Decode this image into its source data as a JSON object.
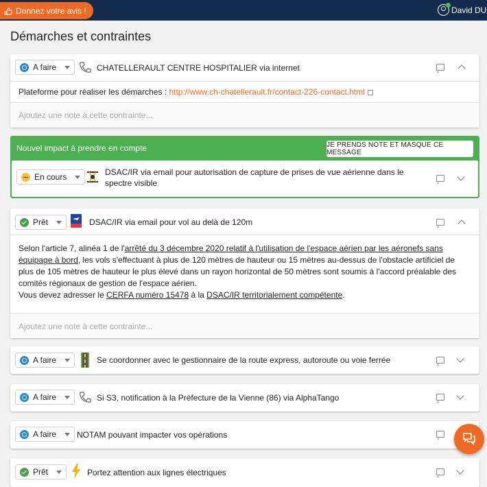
{
  "header": {
    "feedback_label": "Donnez votre avis !",
    "user_name": "David DUR"
  },
  "page": {
    "title": "Démarches et contraintes"
  },
  "note_placeholder": "Ajoutez une note à cette contrainte...",
  "cards": [
    {
      "status": "A faire",
      "title": "CHATELLERAULT CENTRE HOSPITALIER via internet",
      "platform_label": "Plateforme pour réaliser les démarches :",
      "platform_link": "http://www.ch-chatellerault.fr/contact-226-contact.html"
    },
    {
      "impact_label": "Nouvel impact à prendre en compte",
      "dismiss_label": "JE PRENDS NOTE ET MASQUE CE MESSAGE",
      "status": "En cours",
      "title": "DSAC/IR via email pour autorisation de capture de prises de vue aérienne dans le spectre visible"
    },
    {
      "status": "Prêt",
      "title": "DSAC/IR via email pour vol au delà de 120m",
      "body": {
        "p1_a": "Selon l'article 7, alinéa 1 de l'",
        "p1_link": "arrêté du 3 décembre 2020 relatif à l'utilisation de l'espace aérien par les aéronefs sans équipage à bord",
        "p1_b": ", les vols s'effectuant à plus de 120 mètres de hauteur ou 15 mètres au-dessus de l'obstacle artificiel de plus de 105 mètres de hauteur le plus élevé dans un rayon horizontal de 50 mètres sont soumis à l'accord préalable des comités régionaux de gestion de l'espace aérien.",
        "p2_a": "Vous devez adresser le ",
        "p2_link1": "CERFA numéro 15478",
        "p2_b": " à la ",
        "p2_link2": "DSAC/IR territorialement compétente",
        "p2_c": "."
      }
    },
    {
      "status": "A faire",
      "title": "Se coordonner avec le gestionnaire de la route express, autoroute ou voie ferrée"
    },
    {
      "status": "A faire",
      "title": "Si S3, notification à la Préfecture de la Vienne (86) via AlphaTango"
    },
    {
      "status": "A faire",
      "title": "NOTAM pouvant impacter vos opérations"
    },
    {
      "status": "Prêt",
      "title": "Portez attention aux lignes électriques"
    }
  ],
  "colors": {
    "accent": "#f26a21",
    "header_bg": "#132b4c",
    "impact_green": "#4caf50",
    "status_todo": "#1e88e5",
    "status_ready": "#43a047",
    "status_inprogress": "#fbc02d"
  },
  "icons": [
    "feedback-icon",
    "user-icon",
    "phone-icon",
    "drone-icon",
    "dgac-logo-icon",
    "road-icon",
    "lightning-icon",
    "note-icon",
    "chat-icon"
  ]
}
